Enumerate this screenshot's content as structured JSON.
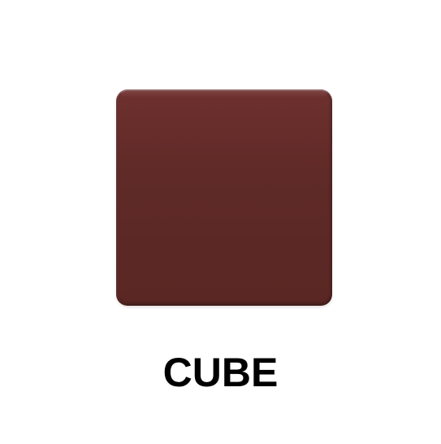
{
  "object": {
    "name": "cube",
    "color": "#5f2a27"
  },
  "caption": {
    "text": "CUBE"
  }
}
